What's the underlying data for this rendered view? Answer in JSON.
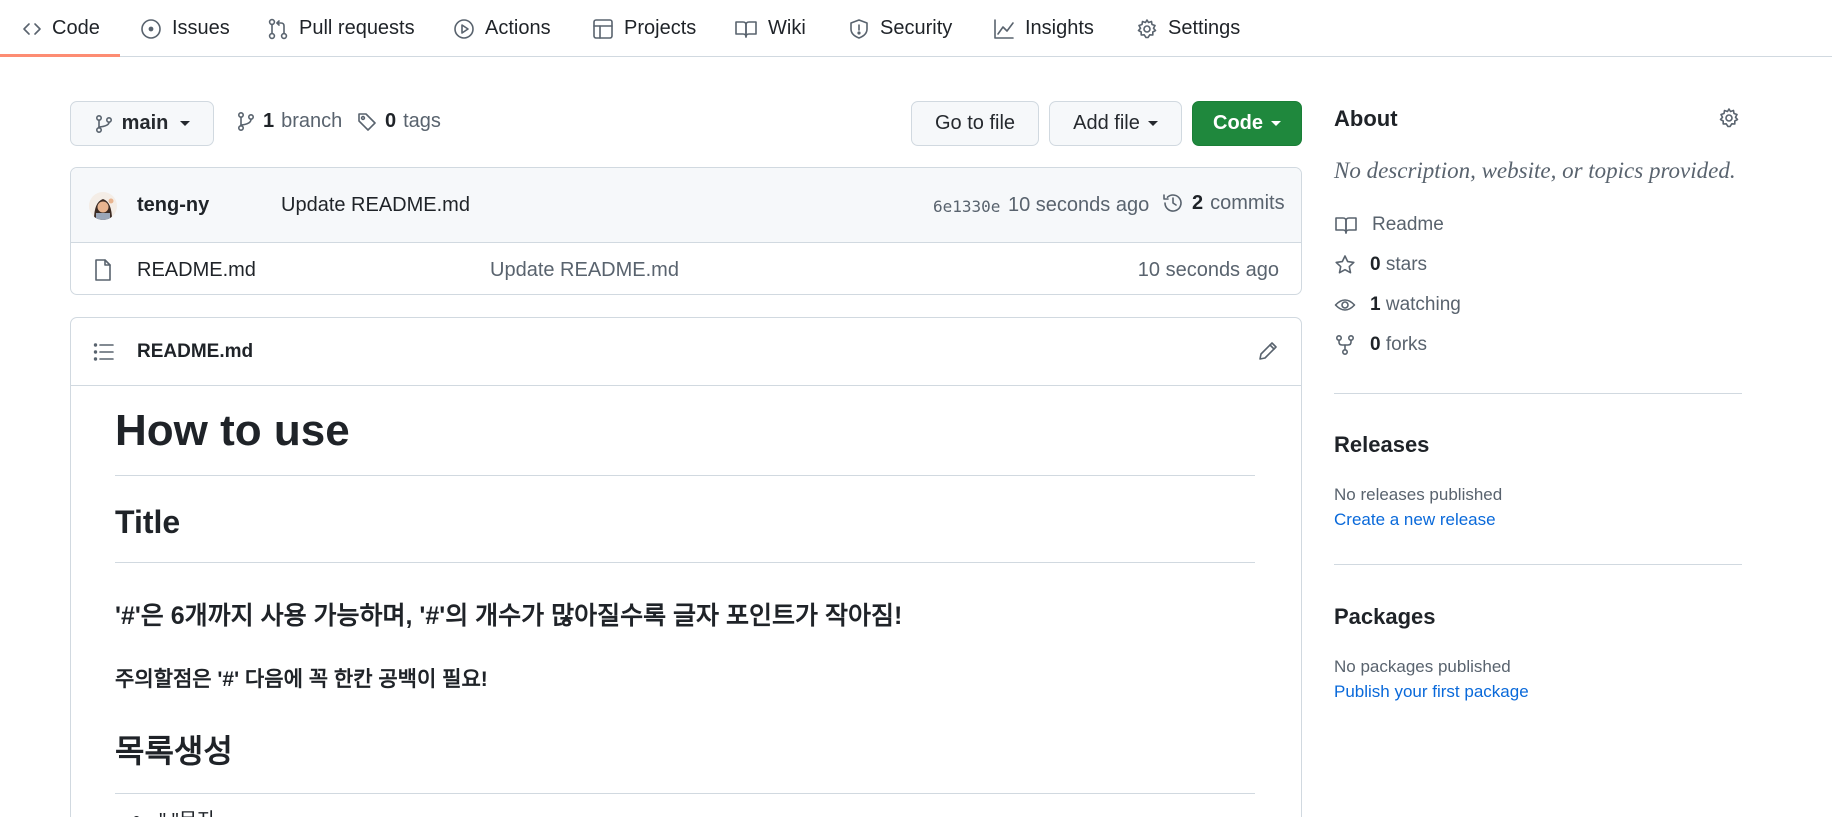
{
  "nav": {
    "tabs": [
      {
        "label": "Code",
        "icon": "code-icon"
      },
      {
        "label": "Issues",
        "icon": "issue-opened-icon"
      },
      {
        "label": "Pull requests",
        "icon": "git-pull-request-icon"
      },
      {
        "label": "Actions",
        "icon": "play-icon"
      },
      {
        "label": "Projects",
        "icon": "table-icon"
      },
      {
        "label": "Wiki",
        "icon": "book-icon"
      },
      {
        "label": "Security",
        "icon": "shield-icon"
      },
      {
        "label": "Insights",
        "icon": "graph-icon"
      },
      {
        "label": "Settings",
        "icon": "gear-icon"
      }
    ],
    "active_tab": "Code",
    "active_color": "#fd8c73"
  },
  "branch_bar": {
    "branch_name": "main",
    "branch_count": "1",
    "branch_label": "branch",
    "tag_count": "0",
    "tag_label": "tags",
    "go_to_file_label": "Go to file",
    "add_file_label": "Add file",
    "code_label": "Code",
    "code_button_color": "#1f883d"
  },
  "commit": {
    "author": "teng-ny",
    "message": "Update README.md",
    "sha": "6e1330e",
    "time": "10 seconds ago",
    "commit_count": "2",
    "commit_label": "commits"
  },
  "files": [
    {
      "name": "README.md",
      "message": "Update README.md",
      "time": "10 seconds ago",
      "icon": "file-icon"
    }
  ],
  "readme": {
    "title": "README.md",
    "h1": "How to use",
    "h2_title": "Title",
    "h3_note": "'#'은 6개까지 사용 가능하며, '#'의 개수가 많아질수록 글자 포인트가 작아짐!",
    "h4_note": "주의할점은 '#' 다음에 꼭 한칸 공백이 필요!",
    "h2_list": "목록생성",
    "list_item_1": "\" \"문자"
  },
  "about": {
    "title": "About",
    "description": "No description, website, or topics provided.",
    "readme_label": "Readme",
    "stars_count": "0",
    "stars_label": "stars",
    "watching_count": "1",
    "watching_label": "watching",
    "forks_count": "0",
    "forks_label": "forks"
  },
  "releases": {
    "title": "Releases",
    "empty_text": "No releases published",
    "create_link": "Create a new release"
  },
  "packages": {
    "title": "Packages",
    "empty_text": "No packages published",
    "publish_link": "Publish your first package"
  },
  "colors": {
    "link": "#0969da",
    "muted_text": "#59636e",
    "border": "#d1d9e0"
  }
}
